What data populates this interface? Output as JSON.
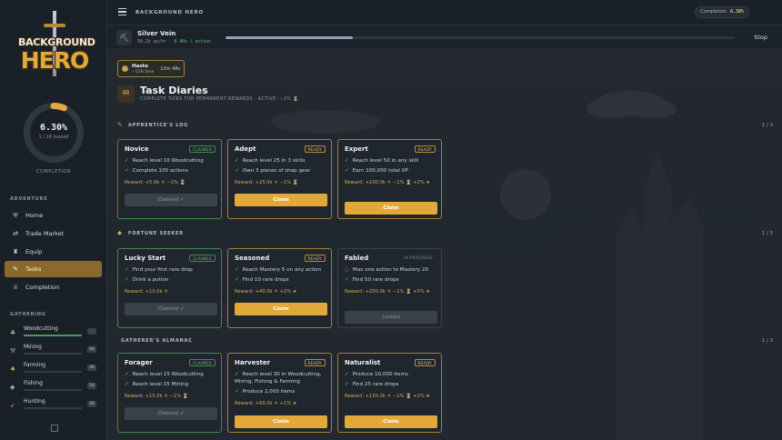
{
  "brand": {
    "logo_line1": "BACKGROUND",
    "logo_line2": "HERO",
    "title": "BACKGROUND HERO"
  },
  "completion": {
    "percent_text": "6.30%",
    "percent": 6.3,
    "sub": "1 / 18 maxed",
    "label": "COMPLETION",
    "pill_label": "Completion",
    "pill_value": "6.30%"
  },
  "sidebar": {
    "adventure_heading": "ADVENTURE",
    "nav": [
      {
        "label": "Home",
        "icon": "shield-icon"
      },
      {
        "label": "Trade Market",
        "icon": "market-icon"
      },
      {
        "label": "Equip",
        "icon": "backpack-icon"
      },
      {
        "label": "Tasks",
        "icon": "tasks-icon",
        "active": true
      },
      {
        "label": "Completion",
        "icon": "trophy-icon"
      }
    ],
    "gathering_heading": "GATHERING",
    "skills": [
      {
        "name": "Woodcutting",
        "level": "-",
        "progress": 1.0,
        "icon": "tree-icon"
      },
      {
        "name": "Mining",
        "level": "68",
        "progress": 0.0,
        "icon": "pickaxe-icon"
      },
      {
        "name": "Farming",
        "level": "46",
        "progress": 0.0,
        "icon": "sprout-icon"
      },
      {
        "name": "Fishing",
        "level": "58",
        "progress": 0.0,
        "icon": "fish-icon"
      },
      {
        "name": "Hunting",
        "level": "46",
        "progress": 0.0,
        "icon": "bow-icon"
      }
    ]
  },
  "action": {
    "name": "Silver Vein",
    "xp": "50.2k xp/hr",
    "sep": "·",
    "time": "0.40s / action",
    "progress": 0.25,
    "stop_label": "Stop"
  },
  "buff": {
    "name": "Haste",
    "desc": "−12% time",
    "remaining": "13m 48s"
  },
  "page": {
    "title": "Task Diaries",
    "subtitle": "COMPLETE TIERS FOR PERMANENT REWARDS · ACTIVE: −2% ⏳"
  },
  "sections": [
    {
      "title": "APPRENTICE'S LOG",
      "page": "1 / 3",
      "icon": "scroll-icon",
      "cards": [
        {
          "title": "Novice",
          "status": "CLAIMED",
          "reqs": [
            "Reach level 10 Woodcutting",
            "Complete 100 actions"
          ],
          "reward": "Reward: +5.0k ⚜  −1% ⏳",
          "button": "Claimed ✓"
        },
        {
          "title": "Adept",
          "status": "READY",
          "reqs": [
            "Reach level 25 in 3 skills",
            "Own 3 pieces of shop gear"
          ],
          "reward": "Reward: +25.0k ⚜  −1% ⏳",
          "button": "Claim"
        },
        {
          "title": "Expert",
          "status": "READY",
          "reqs": [
            "Reach level 50 in any skill",
            "Earn 100,000 total XP"
          ],
          "reward": "Reward: +100.0k ⚜  −1% ⏳  +2% ★",
          "button": "Claim"
        }
      ]
    },
    {
      "title": "FORTUNE SEEKER",
      "page": "1 / 3",
      "icon": "gem-icon",
      "cards": [
        {
          "title": "Lucky Start",
          "status": "CLAIMED",
          "reqs": [
            "Find your first rare drop",
            "Drink a potion"
          ],
          "reward": "Reward: +10.0k ⚜",
          "button": "Claimed ✓"
        },
        {
          "title": "Seasoned",
          "status": "READY",
          "reqs": [
            "Reach Mastery 5 on any action",
            "Find 10 rare drops"
          ],
          "reward": "Reward: +40.0k ⚜  +2% ★",
          "button": "Claim"
        },
        {
          "title": "Fabled",
          "status": "IN PROGRESS",
          "reqs": [
            "Max one action to Mastery 20",
            "Find 50 rare drops"
          ],
          "reward": "Reward: +250.0k ⚜  −1% ⏳  +5% ★",
          "button": "Locked"
        }
      ]
    },
    {
      "title": "GATHERER'S ALMANAC",
      "page": "1 / 3",
      "icon": "",
      "cards": [
        {
          "title": "Forager",
          "status": "CLAIMED",
          "reqs": [
            "Reach level 15 Woodcutting",
            "Reach level 15 Mining"
          ],
          "reward": "Reward: +15.0k ⚜  −1% ⏳",
          "button": "Claimed ✓"
        },
        {
          "title": "Harvester",
          "status": "READY",
          "reqs": [
            "Reach level 30 in Woodcutting, Mining, Fishing & Farming",
            "Produce 2,000 items"
          ],
          "reward": "Reward: +60.0k ⚜  +1% ★",
          "button": "Claim"
        },
        {
          "title": "Naturalist",
          "status": "READY",
          "reqs": [
            "Produce 10,000 items",
            "Find 25 rare drops"
          ],
          "reward": "Reward: +150.0k ⚜  −1% ⏳  +2% ★",
          "button": "Claim"
        }
      ]
    }
  ],
  "colors": {
    "accent": "#e2a93a",
    "ready": "#a57f36",
    "claimed": "#3f8a4a",
    "check": "#5fbf72"
  }
}
